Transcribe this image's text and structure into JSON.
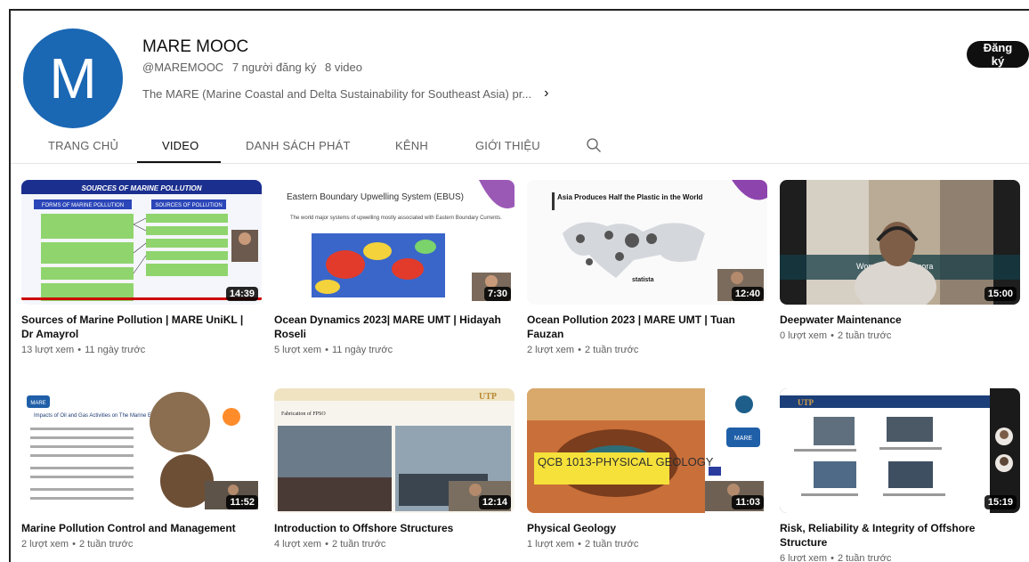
{
  "channel": {
    "avatar_letter": "M",
    "name": "MARE MOOC",
    "handle": "@MAREMOOC",
    "subscribers": "7 người đăng ký",
    "video_count": "8 video",
    "description": "The MARE (Marine Coastal and Delta Sustainability for Southeast Asia) pr...",
    "subscribe_label": "Đăng ký"
  },
  "tabs": [
    {
      "label": "TRANG CHỦ"
    },
    {
      "label": "VIDEO"
    },
    {
      "label": "DANH SÁCH PHÁT"
    },
    {
      "label": "KÊNH"
    },
    {
      "label": "GIỚI THIỆU"
    }
  ],
  "videos": [
    {
      "title": "Sources of Marine Pollution | MARE UniKL | Dr Amayrol",
      "views": "13 lượt xem",
      "age": "11 ngày trước",
      "duration": "14:39"
    },
    {
      "title": "Ocean Dynamics 2023| MARE UMT | Hidayah Roseli",
      "views": "5 lượt xem",
      "age": "11 ngày trước",
      "duration": "7:30"
    },
    {
      "title": "Ocean Pollution 2023 | MARE UMT | Tuan Fauzan",
      "views": "2 lượt xem",
      "age": "2 tuần trước",
      "duration": "12:40"
    },
    {
      "title": "Deepwater Maintenance",
      "views": "0 lượt xem",
      "age": "2 tuần trước",
      "duration": "15:00"
    },
    {
      "title": "Marine Pollution Control and Management",
      "views": "2 lượt xem",
      "age": "2 tuần trước",
      "duration": "11:52"
    },
    {
      "title": "Introduction to Offshore Structures",
      "views": "4 lượt xem",
      "age": "2 tuần trước",
      "duration": "12:14"
    },
    {
      "title": "Physical Geology",
      "views": "1 lượt xem",
      "age": "2 tuần trước",
      "duration": "11:03"
    },
    {
      "title": "Risk, Reliability & Integrity of Offshore Structure",
      "views": "6 lượt xem",
      "age": "2 tuần trước",
      "duration": "15:19"
    }
  ],
  "thumb_text": {
    "t1_title": "SOURCES OF MARINE POLLUTION",
    "t1_left": "FORMS OF MARINE POLLUTION",
    "t1_right": "SOURCES OF POLLUTION",
    "t2_title": "Eastern Boundary Upwelling System (EBUS)",
    "t2_text": "The world major systems of upwelling mostly associated with Eastern Boundary Currents.",
    "t3_title": "Asia Produces Half the Plastic in the World",
    "t3_brand": "statista",
    "t4_watermark": "Wondershare Filmora",
    "t5_title": "Impacts of Oil and Gas Activities on The Marine Environment",
    "t5_logo": "MARE",
    "t6_title": "Fabrication of FPSO",
    "t6_logo": "UTP",
    "t7_caption": "QCB 1013-PHYSICAL GEOLOGY",
    "t7_logo": "MARE",
    "t8_logo": "UTP"
  }
}
